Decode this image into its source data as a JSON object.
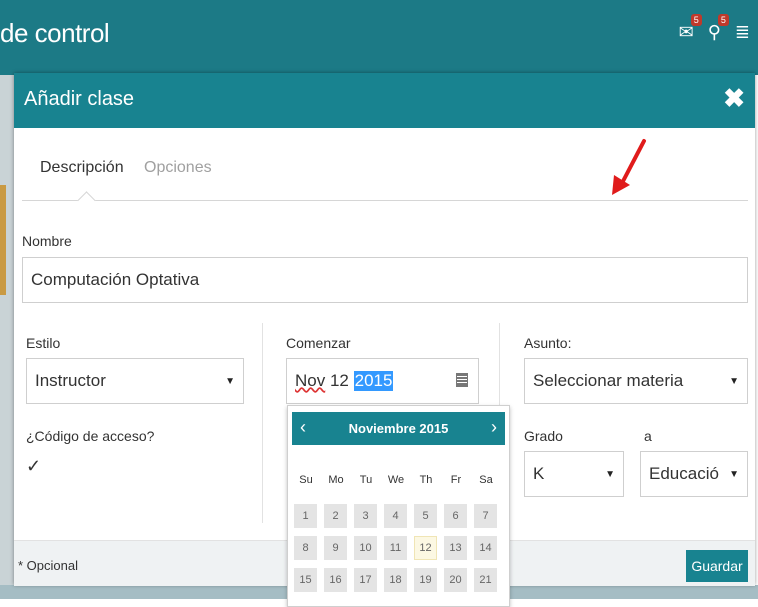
{
  "app": {
    "title": "de control",
    "badge1": "5",
    "badge2": "5"
  },
  "modal": {
    "title": "Añadir clase",
    "close_label": "✖",
    "tabs": [
      {
        "label": "Descripción",
        "active": true
      },
      {
        "label": "Opciones",
        "active": false
      }
    ],
    "nombre": {
      "label": "Nombre",
      "value": "Computación Optativa"
    },
    "estilo": {
      "label": "Estilo",
      "value": "Instructor"
    },
    "codigo": {
      "label": "¿Código de acceso?",
      "checked": true,
      "mark": "✓"
    },
    "comenzar": {
      "label": "Comenzar",
      "month": "Nov",
      "day": "12",
      "year": "2015"
    },
    "asunto": {
      "label": "Asunto:",
      "value": "Seleccionar materia"
    },
    "grado": {
      "label": "Grado",
      "value": "K"
    },
    "a": {
      "label": "a",
      "value": "Educació"
    },
    "footer": {
      "optional": "* Opcional",
      "save": "Guardar"
    }
  },
  "datepicker": {
    "month_label": "Noviembre 2015",
    "prev": "‹",
    "next": "›",
    "weekdays": [
      "Su",
      "Mo",
      "Tu",
      "We",
      "Th",
      "Fr",
      "Sa"
    ],
    "weeks": [
      [
        "1",
        "2",
        "3",
        "4",
        "5",
        "6",
        "7"
      ],
      [
        "8",
        "9",
        "10",
        "11",
        "12",
        "13",
        "14"
      ],
      [
        "15",
        "16",
        "17",
        "18",
        "19",
        "20",
        "21"
      ]
    ],
    "today": "12"
  },
  "colors": {
    "primary": "#188390",
    "annotation_arrow": "#e01b1b"
  }
}
